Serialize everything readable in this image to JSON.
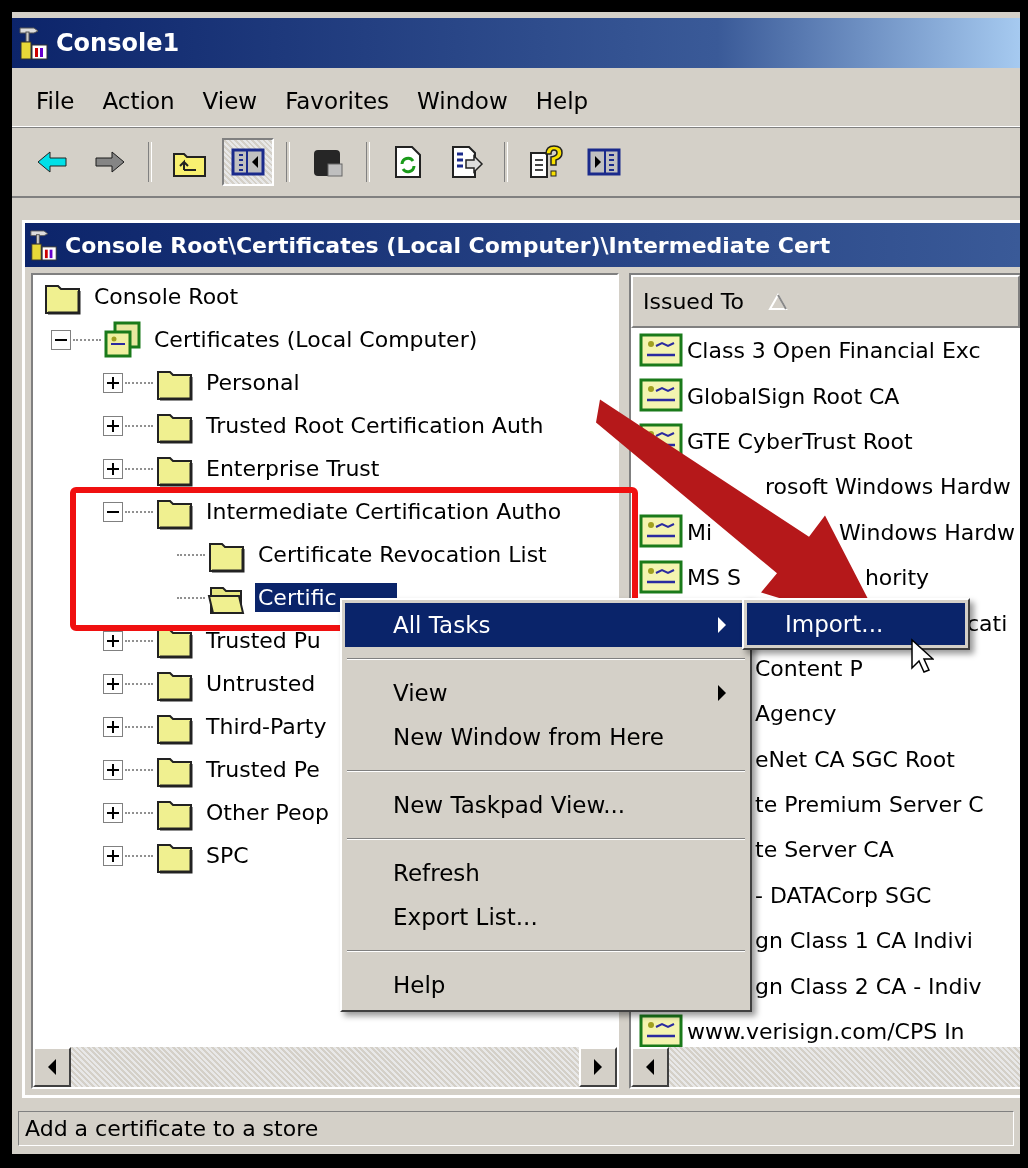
{
  "window": {
    "title": "Console1"
  },
  "menu_bar": [
    {
      "label": "File"
    },
    {
      "label": "Action"
    },
    {
      "label": "View"
    },
    {
      "label": "Favorites"
    },
    {
      "label": "Window"
    },
    {
      "label": "Help"
    }
  ],
  "toolbar": [
    {
      "kind": "back",
      "disabled": false,
      "pressed": false
    },
    {
      "kind": "forward",
      "disabled": true,
      "pressed": false
    },
    {
      "kind": "separator"
    },
    {
      "kind": "up",
      "disabled": false,
      "pressed": false
    },
    {
      "kind": "tree",
      "disabled": false,
      "pressed": true
    },
    {
      "kind": "separator"
    },
    {
      "kind": "delete",
      "disabled": true,
      "pressed": false
    },
    {
      "kind": "separator"
    },
    {
      "kind": "refresh",
      "disabled": false,
      "pressed": false
    },
    {
      "kind": "export",
      "disabled": false,
      "pressed": false
    },
    {
      "kind": "separator"
    },
    {
      "kind": "help",
      "disabled": false,
      "pressed": false
    },
    {
      "kind": "pane",
      "disabled": false,
      "pressed": false
    }
  ],
  "child_window": {
    "title": "Console Root\\Certificates (Local Computer)\\Intermediate Cert"
  },
  "tree": {
    "items": [
      {
        "label": "Console Root",
        "kind": "root",
        "selected": false,
        "children": [
          {
            "label": "Certificates (Local Computer)",
            "kind": "snapin",
            "expanded": true,
            "selected": false,
            "children": [
              {
                "label": "Personal",
                "kind": "folder",
                "expanded": false,
                "selected": false
              },
              {
                "label": "Trusted Root Certification Auth",
                "kind": "folder",
                "expanded": false,
                "selected": false
              },
              {
                "label": "Enterprise Trust",
                "kind": "folder",
                "expanded": false,
                "selected": false
              },
              {
                "label": "Intermediate Certification Autho",
                "kind": "folder",
                "expanded": true,
                "selected": false,
                "children": [
                  {
                    "label": "Certificate Revocation List",
                    "kind": "folder",
                    "selected": false
                  },
                  {
                    "label": "Certific",
                    "kind": "open_folder",
                    "selected": true
                  }
                ]
              },
              {
                "label": "Trusted Pu",
                "kind": "folder",
                "expanded": false,
                "selected": false
              },
              {
                "label": "Untrusted",
                "kind": "folder",
                "expanded": false,
                "selected": false
              },
              {
                "label": "Third-Party",
                "kind": "folder",
                "expanded": false,
                "selected": false
              },
              {
                "label": "Trusted Pe",
                "kind": "folder",
                "expanded": false,
                "selected": false
              },
              {
                "label": "Other Peop",
                "kind": "folder",
                "expanded": false,
                "selected": false
              },
              {
                "label": "SPC",
                "kind": "folder",
                "expanded": false,
                "selected": false
              }
            ]
          }
        ]
      }
    ]
  },
  "list": {
    "columns": [
      {
        "label": "Issued To",
        "sorted": true
      }
    ],
    "rows": [
      {
        "kind": "full",
        "parts": [
          "Class 3 Open Financial Exc"
        ]
      },
      {
        "kind": "full",
        "parts": [
          "GlobalSign Root CA"
        ]
      },
      {
        "kind": "full",
        "parts": [
          "GTE CyberTrust Root"
        ]
      },
      {
        "kind": "behind_arrow",
        "parts": [
          "rosoft Windows Hardw"
        ]
      },
      {
        "kind": "split",
        "parts": [
          "Mi",
          "Windows Hardw"
        ]
      },
      {
        "kind": "split_wide",
        "parts": [
          "MS S",
          "hority"
        ]
      },
      {
        "kind": "under_submenu",
        "parts": [
          "cati"
        ]
      },
      {
        "kind": "covered",
        "parts": [
          "Content P"
        ]
      },
      {
        "kind": "covered",
        "parts": [
          "Agency"
        ]
      },
      {
        "kind": "covered",
        "parts": [
          "eNet CA SGC Root"
        ]
      },
      {
        "kind": "covered",
        "parts": [
          "te Premium Server C"
        ]
      },
      {
        "kind": "covered",
        "parts": [
          "te Server CA"
        ]
      },
      {
        "kind": "covered",
        "parts": [
          "- DATACorp SGC"
        ]
      },
      {
        "kind": "covered",
        "parts": [
          "gn Class 1 CA Indivi"
        ]
      },
      {
        "kind": "covered",
        "parts": [
          "gn Class 2 CA - Indiv"
        ]
      },
      {
        "kind": "full",
        "parts": [
          "www.verisign.com/CPS In"
        ]
      }
    ]
  },
  "context_menu": {
    "items": [
      {
        "kind": "item",
        "label": "All Tasks",
        "submenu": true,
        "selected": true
      },
      {
        "kind": "separator"
      },
      {
        "kind": "item",
        "label": "View",
        "submenu": true,
        "selected": false
      },
      {
        "kind": "item",
        "label": "New Window from Here",
        "submenu": false,
        "selected": false
      },
      {
        "kind": "separator"
      },
      {
        "kind": "item",
        "label": "New Taskpad View...",
        "submenu": false,
        "selected": false
      },
      {
        "kind": "separator"
      },
      {
        "kind": "item",
        "label": "Refresh",
        "submenu": false,
        "selected": false
      },
      {
        "kind": "item",
        "label": "Export List...",
        "submenu": false,
        "selected": false
      },
      {
        "kind": "separator"
      },
      {
        "kind": "item",
        "label": "Help",
        "submenu": false,
        "selected": false
      }
    ]
  },
  "submenu": {
    "items": [
      {
        "label": "Import...",
        "selected": true
      }
    ]
  },
  "status_bar": {
    "text": "Add a certificate to a store"
  }
}
